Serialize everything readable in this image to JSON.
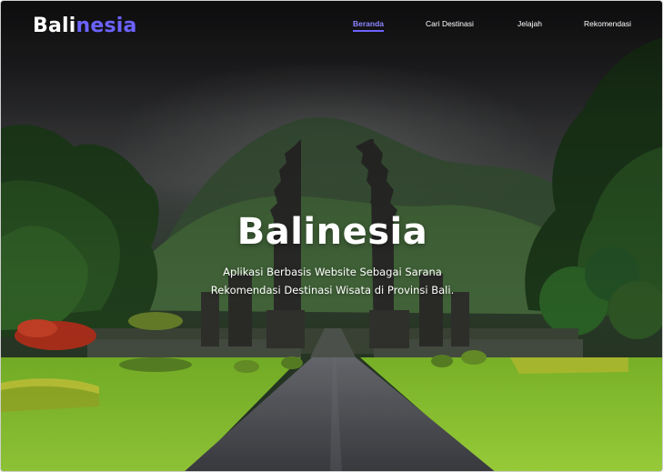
{
  "header": {
    "logo_part1": "Bali",
    "logo_part2": "nesia",
    "nav": [
      {
        "label": "Beranda",
        "active": true
      },
      {
        "label": "Cari Destinasi",
        "active": false
      },
      {
        "label": "Jelajah",
        "active": false
      },
      {
        "label": "Rekomendasi",
        "active": false
      }
    ]
  },
  "hero": {
    "title": "Balinesia",
    "subtitle_line1": "Aplikasi Berbasis Website Sebagai Sarana",
    "subtitle_line2": "Rekomendasi Destinasi Wisata di Provinsi Bali.",
    "background": "temple-gate-photo"
  },
  "colors": {
    "accent": "#6c63ff",
    "text": "#ffffff"
  }
}
